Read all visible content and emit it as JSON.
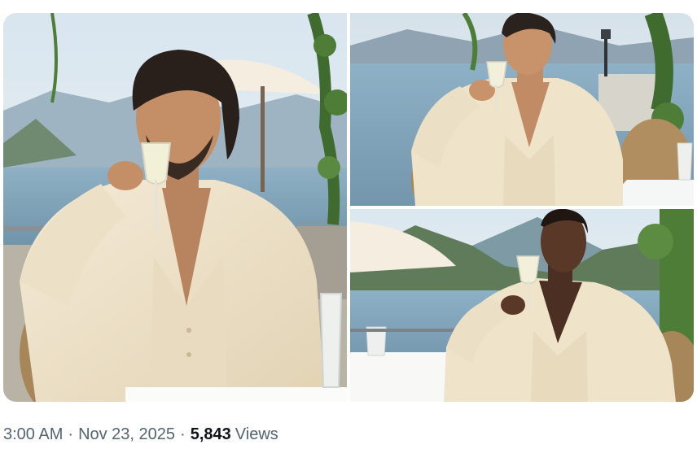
{
  "post": {
    "media": [
      {
        "id": "photo-1",
        "icon": "photo"
      },
      {
        "id": "photo-2",
        "icon": "photo"
      },
      {
        "id": "photo-3",
        "icon": "photo"
      }
    ],
    "time": "3:00 AM",
    "separator": "·",
    "date": "Nov 23, 2025",
    "views_count": "5,843",
    "views_label": "Views"
  },
  "colors": {
    "meta_text": "#536471",
    "views_count": "#0f1419",
    "suit": "#efe3c9",
    "lake": "#7d9fb3",
    "sky": "#dde8f0"
  }
}
